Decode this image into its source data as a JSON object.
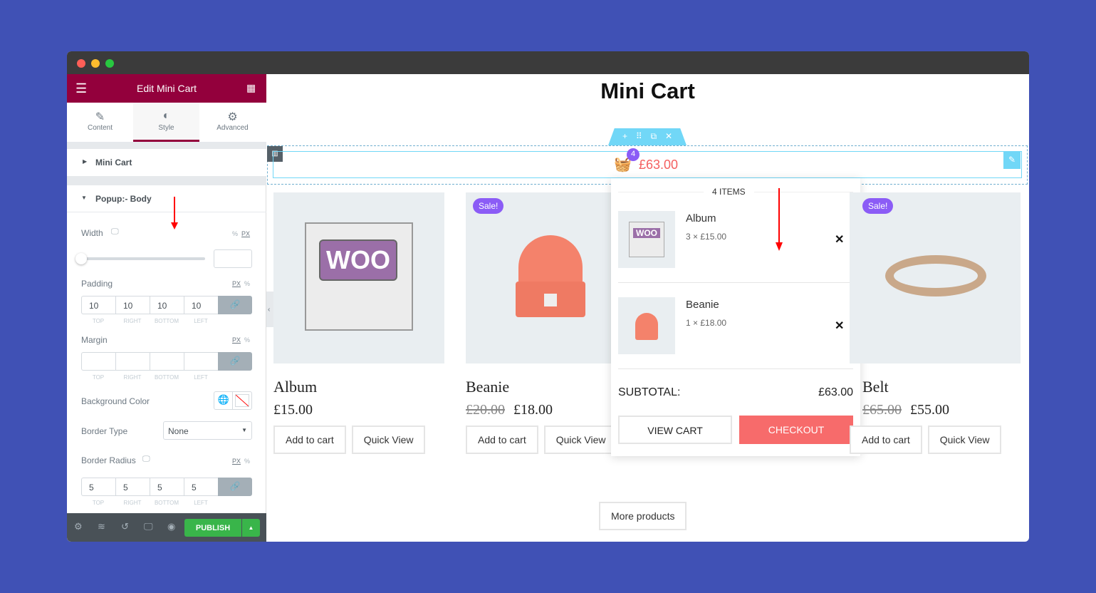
{
  "window": {
    "dots": [
      "#ff5f57",
      "#febc2e",
      "#28c840"
    ]
  },
  "sidebar": {
    "title": "Edit Mini Cart",
    "tabs": [
      {
        "label": "Content",
        "icon": "pencil-icon"
      },
      {
        "label": "Style",
        "icon": "contrast-icon"
      },
      {
        "label": "Advanced",
        "icon": "gear-icon"
      }
    ],
    "sections": {
      "mini_cart": "Mini Cart",
      "popup_body": "Popup:- Body"
    },
    "width": {
      "label": "Width",
      "units": [
        "%",
        "PX"
      ],
      "value": ""
    },
    "padding": {
      "label": "Padding",
      "units": [
        "PX",
        "%"
      ],
      "values": [
        "10",
        "10",
        "10",
        "10"
      ]
    },
    "margin": {
      "label": "Margin",
      "units": [
        "PX",
        "%"
      ],
      "values": [
        "",
        "",
        "",
        ""
      ]
    },
    "sides": [
      "TOP",
      "RIGHT",
      "BOTTOM",
      "LEFT"
    ],
    "background_color": {
      "label": "Background Color"
    },
    "border_type": {
      "label": "Border Type",
      "value": "None"
    },
    "border_radius": {
      "label": "Border Radius",
      "units": [
        "PX",
        "%"
      ],
      "values": [
        "5",
        "5",
        "5",
        "5"
      ]
    },
    "publish": "PUBLISH",
    "accent": "#93003c",
    "publish_color": "#39b54a"
  },
  "page": {
    "title": "Mini Cart",
    "cart": {
      "count": "4",
      "total": "£63.00",
      "color": "#f45f5f",
      "badge_color": "#8b5cf6"
    },
    "products": [
      {
        "name": "Album",
        "old_price": "",
        "price": "£15.00",
        "sale": ""
      },
      {
        "name": "Beanie",
        "old_price": "£20.00",
        "price": "£18.00",
        "sale": "Sale!"
      },
      {
        "name": "Belt",
        "old_price": "£65.00",
        "price": "£55.00",
        "sale": "Sale!"
      }
    ],
    "add_to_cart": "Add to cart",
    "quick_view": "Quick View",
    "more_products": "More products"
  },
  "popup": {
    "items_label": "4 ITEMS",
    "items": [
      {
        "name": "Album",
        "qty": "3 × £15.00"
      },
      {
        "name": "Beanie",
        "qty": "1 × £18.00"
      }
    ],
    "subtotal_label": "SUBTOTAL:",
    "subtotal": "£63.00",
    "view_cart": "VIEW CART",
    "checkout": "CHECKOUT",
    "checkout_color": "#f76b6b"
  }
}
